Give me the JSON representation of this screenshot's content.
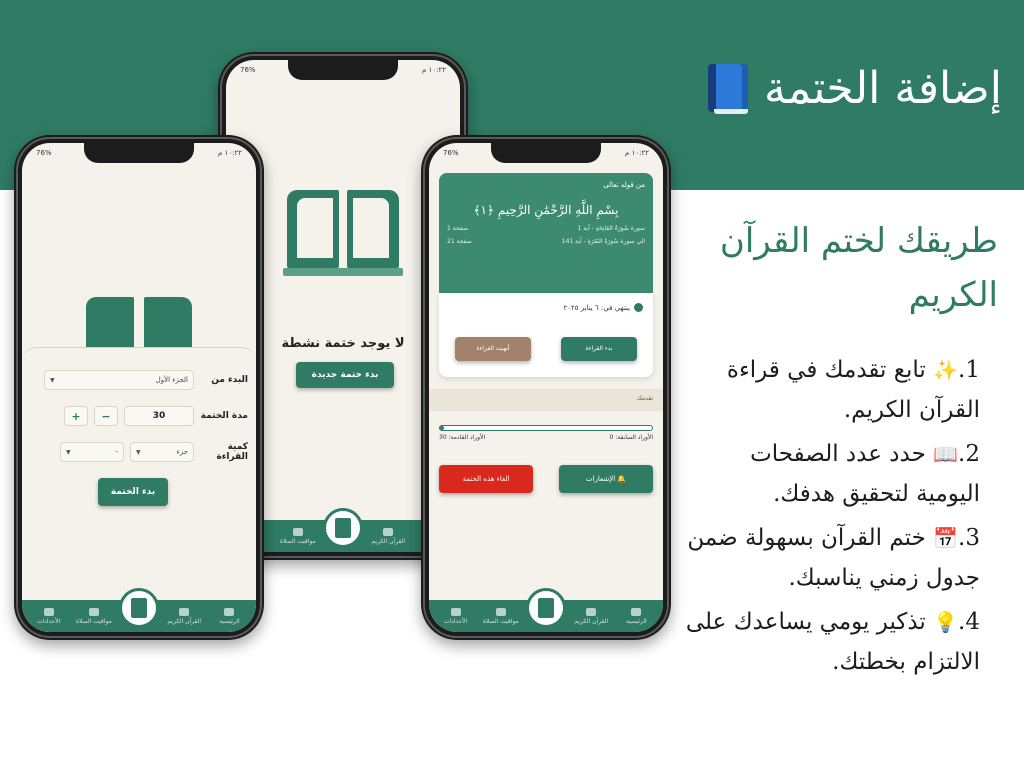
{
  "header": {
    "title": "إضافة الختمة",
    "icon": "blue-book-icon",
    "background": "#2f7b64"
  },
  "subtitle": "طريقك لختم القرآن الكريم",
  "features": [
    {
      "num": "1.",
      "emoji": "✨",
      "text": "تابع تقدمك في قراءة القرآن الكريم."
    },
    {
      "num": "2.",
      "emoji": "📖",
      "text": "حدد عدد الصفحات اليومية لتحقيق هدفك."
    },
    {
      "num": "3.",
      "emoji": "📅",
      "text": "ختم القرآن بسهولة ضمن جدول زمني يناسبك."
    },
    {
      "num": "4.",
      "emoji": "💡",
      "text": "تذكير يومي يساعدك على الالتزام بخطتك."
    }
  ],
  "tabs": {
    "home": "الرئيسية",
    "quran": "القرآن الكريم",
    "prayer": "مواقيت الصلاة",
    "settings": "الأعدادات"
  },
  "left_phone": {
    "status_time": "١٠:٢٢ م",
    "start_label": "البدء من",
    "start_value": "الجزء الأول",
    "duration_label": "مدة الختمة",
    "duration_value": "30",
    "minus": "−",
    "plus": "+",
    "amount_label": "كمية القراءة",
    "amount_unit": "جزء",
    "amount_value": "-",
    "start_button": "بدء الختمة"
  },
  "middle_phone": {
    "status_time": "١٠:٢٢ م",
    "empty_text": "لا يوجد ختمة نشطة",
    "new_button": "بدء ختمة جديدة"
  },
  "right_phone": {
    "status_time": "١٠:٢٢ م",
    "verse_intro": "من قوله تعالى",
    "verse": "بِسْمِ اللَّهِ الرَّحْمَٰنِ الرَّحِيمِ ﴿١﴾",
    "from_surah": "سورة سُورَةُ الفَاتِحَةِ - آية 1",
    "from_page": "صفحة 1",
    "to_surah": "الي سورة سُورَةُ البَقَرَةِ - آية 141",
    "to_page": "صفحة 21",
    "ends_on": "ينتهي في: ٦ يناير ٢٠٢٥",
    "start_reading": "بدء القراءة",
    "finished_reading": "أنهيت القراءة",
    "progress_label": "تقدمك",
    "progress": 0.02,
    "prev_wird": "الأوراد السابقة: 0",
    "next_wird": "الأوراد القادمة: 30",
    "notifications": "الإشعارات",
    "cancel": "الغاء هذه الختمة"
  }
}
